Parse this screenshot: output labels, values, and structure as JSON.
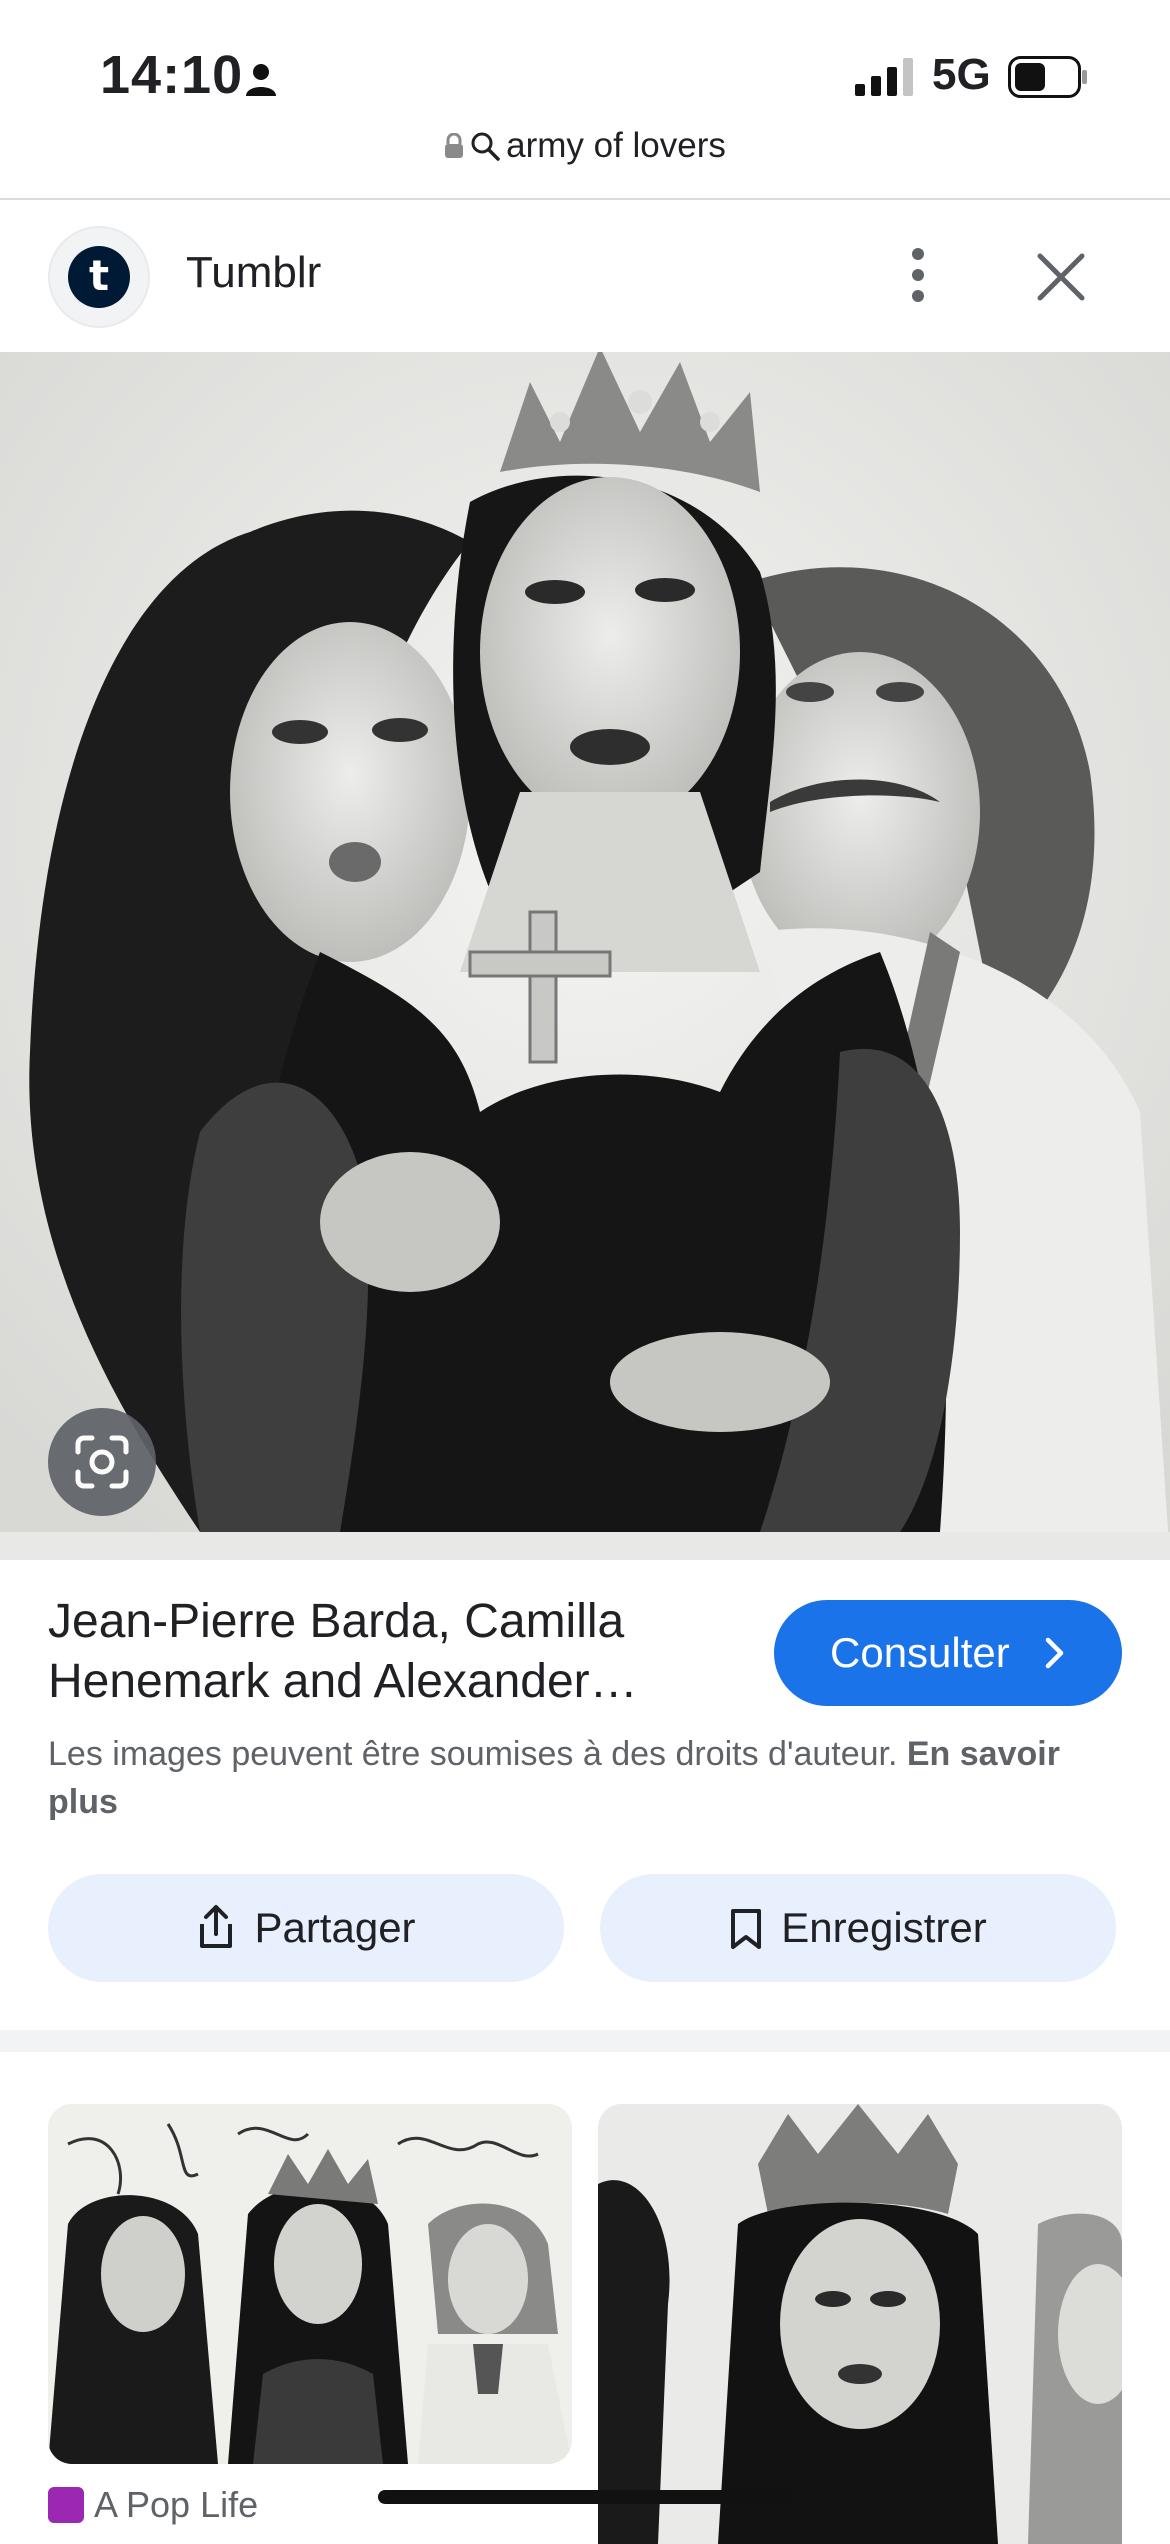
{
  "status_bar": {
    "time": "14:10",
    "network": "5G"
  },
  "address_bar": {
    "query": "army of lovers"
  },
  "source": {
    "name": "Tumblr",
    "logo_letter": "t"
  },
  "result": {
    "title": "Jean-Pierre Barda, Camilla Henemark and Alexander…",
    "visit_label": "Consulter",
    "copyright_text": "Les images peuvent être soumises à des droits d'auteur.",
    "learn_more": "En savoir plus",
    "share_label": "Partager",
    "save_label": "Enregistrer"
  },
  "related": [
    {
      "source": "A Pop Life"
    }
  ],
  "colors": {
    "accent": "#1a73e8",
    "pill_bg": "#e8f0fe",
    "tumblr": "#001935"
  },
  "icons": [
    "person-icon",
    "signal-icon",
    "battery-icon",
    "lock-icon",
    "search-icon",
    "more-vert-icon",
    "close-icon",
    "lens-icon",
    "chevron-right-icon",
    "share-icon",
    "bookmark-icon"
  ]
}
